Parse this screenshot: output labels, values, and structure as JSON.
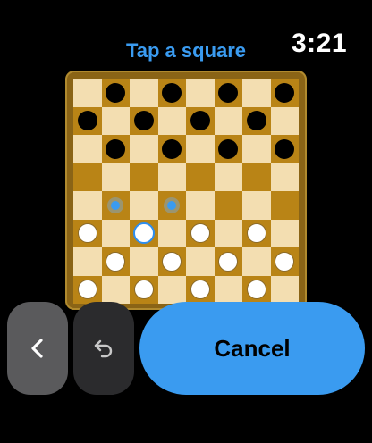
{
  "header": {
    "title": "Tap a square",
    "time": "3:21"
  },
  "board": {
    "size": 8,
    "pieces": [
      {
        "row": 0,
        "col": 1,
        "color": "black"
      },
      {
        "row": 0,
        "col": 3,
        "color": "black"
      },
      {
        "row": 0,
        "col": 5,
        "color": "black"
      },
      {
        "row": 0,
        "col": 7,
        "color": "black"
      },
      {
        "row": 1,
        "col": 0,
        "color": "black"
      },
      {
        "row": 1,
        "col": 2,
        "color": "black"
      },
      {
        "row": 1,
        "col": 4,
        "color": "black"
      },
      {
        "row": 1,
        "col": 6,
        "color": "black"
      },
      {
        "row": 2,
        "col": 1,
        "color": "black"
      },
      {
        "row": 2,
        "col": 3,
        "color": "black"
      },
      {
        "row": 2,
        "col": 5,
        "color": "black"
      },
      {
        "row": 2,
        "col": 7,
        "color": "black"
      },
      {
        "row": 5,
        "col": 0,
        "color": "white"
      },
      {
        "row": 5,
        "col": 2,
        "color": "white",
        "selected": true
      },
      {
        "row": 5,
        "col": 4,
        "color": "white"
      },
      {
        "row": 5,
        "col": 6,
        "color": "white"
      },
      {
        "row": 6,
        "col": 1,
        "color": "white"
      },
      {
        "row": 6,
        "col": 3,
        "color": "white"
      },
      {
        "row": 6,
        "col": 5,
        "color": "white"
      },
      {
        "row": 6,
        "col": 7,
        "color": "white"
      },
      {
        "row": 7,
        "col": 0,
        "color": "white"
      },
      {
        "row": 7,
        "col": 2,
        "color": "white"
      },
      {
        "row": 7,
        "col": 4,
        "color": "white"
      },
      {
        "row": 7,
        "col": 6,
        "color": "white"
      }
    ],
    "move_hints": [
      {
        "row": 4,
        "col": 1
      },
      {
        "row": 4,
        "col": 3
      }
    ],
    "colors": {
      "light_square": "#f3deb1",
      "dark_square": "#b98416",
      "frame": "#8a6416",
      "accent": "#3a9bf0"
    }
  },
  "controls": {
    "back_icon": "chevron-left-icon",
    "undo_icon": "undo-icon",
    "cancel_label": "Cancel"
  }
}
